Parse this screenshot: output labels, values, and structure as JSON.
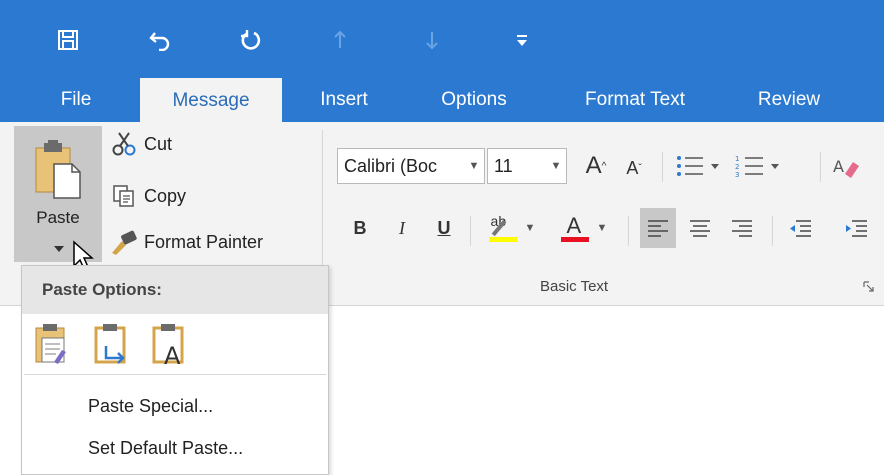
{
  "colors": {
    "ribbon_blue": "#2b79d0",
    "ribbon_bg": "#f3f3f3",
    "highlight_yellow": "#ffff00",
    "font_color_red": "#e81123",
    "active_tab_text": "#2b6cb8"
  },
  "quick_access": {
    "icons": [
      "save-icon",
      "undo-icon",
      "redo-icon",
      "previous-item-icon",
      "next-item-icon",
      "customize-qat-icon"
    ]
  },
  "tabs": [
    {
      "label": "File"
    },
    {
      "label": "Message",
      "active": true
    },
    {
      "label": "Insert"
    },
    {
      "label": "Options"
    },
    {
      "label": "Format Text"
    },
    {
      "label": "Review"
    }
  ],
  "clipboard": {
    "paste_label": "Paste",
    "cut_label": "Cut",
    "copy_label": "Copy",
    "format_painter_label": "Format Painter"
  },
  "basic_text": {
    "font_name": "Calibri (Boc",
    "font_size": "11",
    "group_label": "Basic Text",
    "bold": "B",
    "italic": "I",
    "underline": "U",
    "grow_font": "A",
    "shrink_font": "A",
    "font_color_letter": "A",
    "highlight_letters": "ab"
  },
  "paste_menu": {
    "header": "Paste Options:",
    "option_icons": [
      "keep-source-formatting-icon",
      "merge-formatting-icon",
      "keep-text-only-icon"
    ],
    "paste_special_label": "Paste Special...",
    "set_default_paste_label": "Set Default Paste..."
  }
}
